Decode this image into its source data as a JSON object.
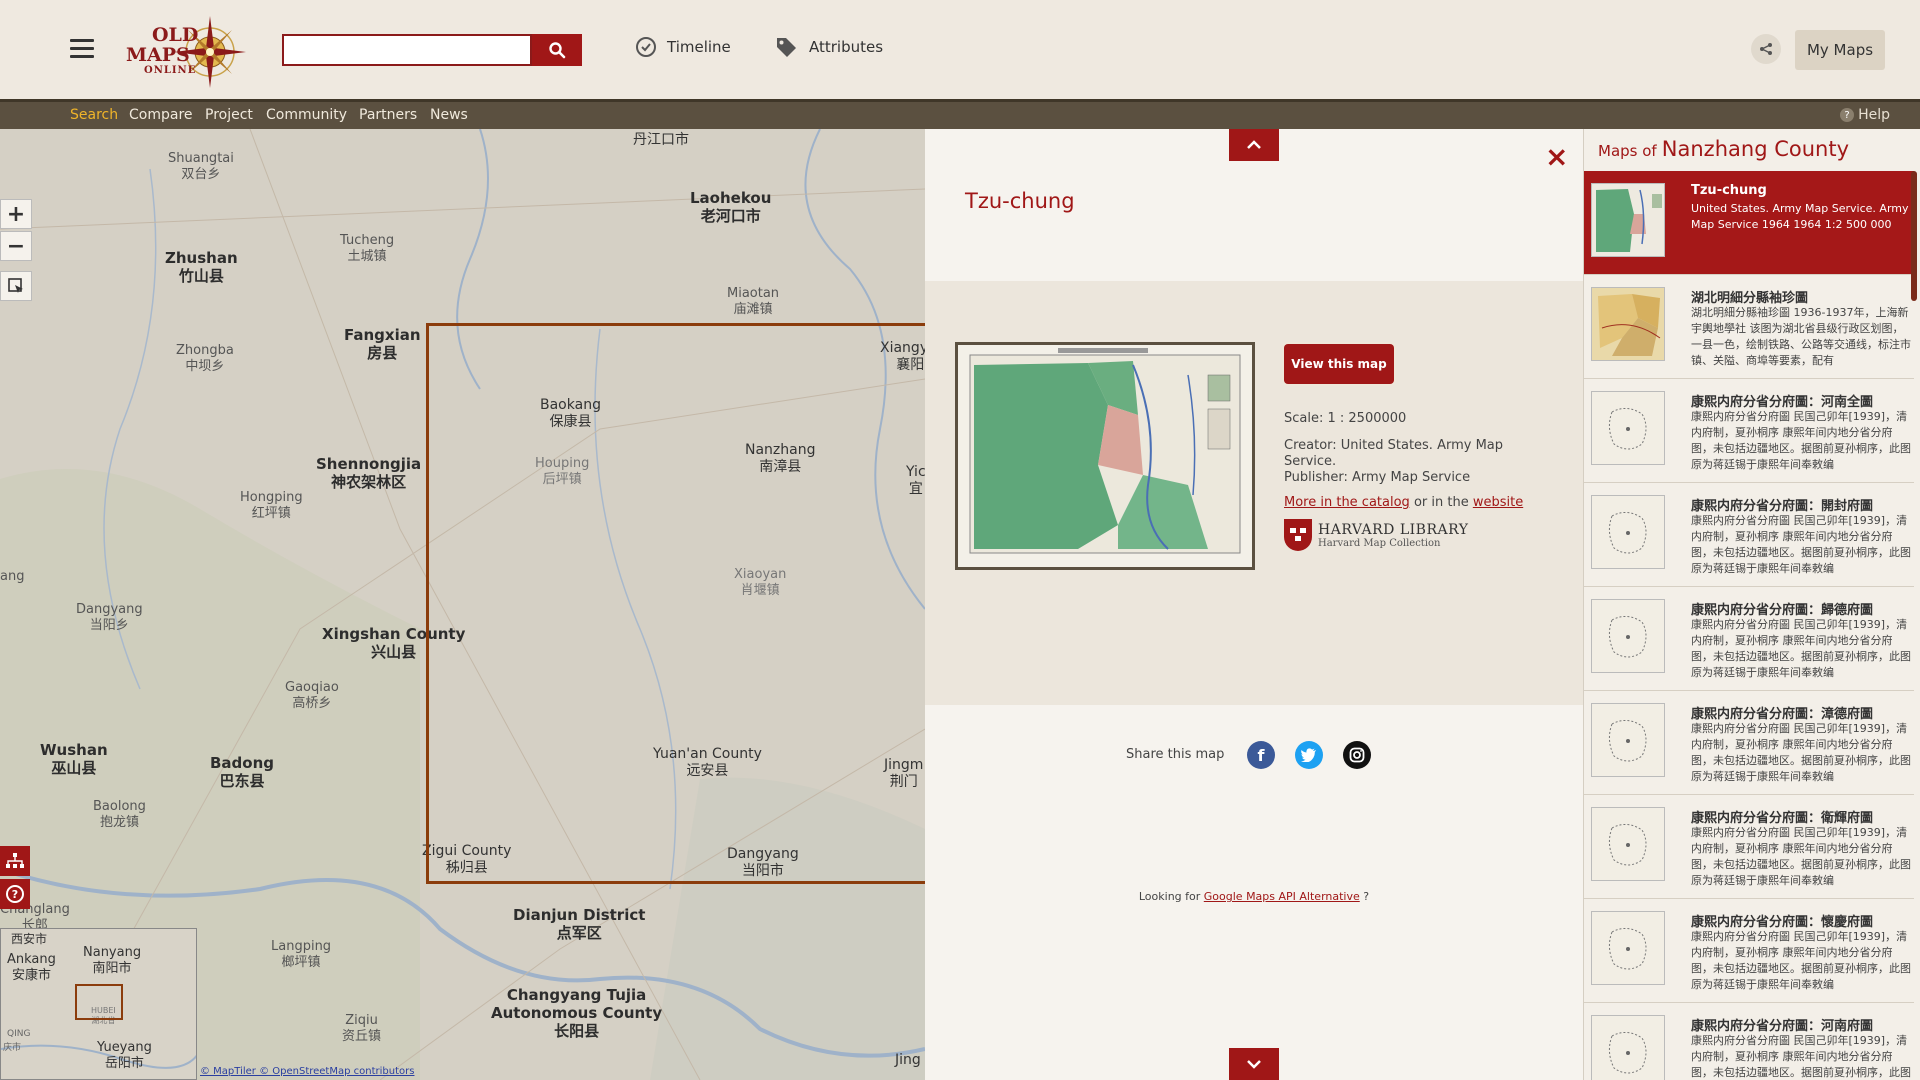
{
  "header": {
    "logo_line1": "OLD",
    "logo_line2": "MAPS",
    "logo_line3": "ONLINE",
    "search_value": "",
    "timeline_label": "Timeline",
    "attributes_label": "Attributes",
    "mymaps_label": "My Maps"
  },
  "subnav": {
    "items": [
      "Search",
      "Compare",
      "Project",
      "Community",
      "Partners",
      "News"
    ],
    "help_label": "Help"
  },
  "map": {
    "places": [
      {
        "name": "丹江口市"
      },
      {
        "name": "Shuangtai",
        "name2": "双台乡"
      },
      {
        "name": "Laohekou",
        "name2": "老河口市"
      },
      {
        "name": "Zhushan",
        "name2": "竹山县"
      },
      {
        "name": "Tucheng",
        "name2": "土城镇"
      },
      {
        "name": "Miaotan",
        "name2": "庙滩镇"
      },
      {
        "name": "Zhongba",
        "name2": "中坝乡"
      },
      {
        "name": "Fangxian",
        "name2": "房县"
      },
      {
        "name": "Xiangyang",
        "name2": "襄阳市"
      },
      {
        "name": "Baokang",
        "name2": "保康县"
      },
      {
        "name": "Houping",
        "name2": "后坪镇"
      },
      {
        "name": "Nanzhang",
        "name2": "南漳县"
      },
      {
        "name": "Shennongjia",
        "name2": "神农架林区"
      },
      {
        "name": "Hongping",
        "name2": "红坪镇"
      },
      {
        "name": "Xiaoyan",
        "name2": "肖堰镇"
      },
      {
        "name": "Dangyang",
        "name2": "当阳乡"
      },
      {
        "name": "Xingshan County",
        "name2": "兴山县"
      },
      {
        "name": "Gaoqiao",
        "name2": "高桥乡"
      },
      {
        "name": "Wushan",
        "name2": "巫山县"
      },
      {
        "name": "Badong",
        "name2": "巴东县"
      },
      {
        "name": "Yuan'an County",
        "name2": "远安县"
      },
      {
        "name": "Baolong",
        "name2": "抱龙镇"
      },
      {
        "name": "Zigui County",
        "name2": "秭归县"
      },
      {
        "name": "Dangyang",
        "name2": "当阳市"
      },
      {
        "name": "Dianjun District",
        "name2": "点军区"
      },
      {
        "name": "Changlang",
        "name2": "长郎"
      },
      {
        "name": "Langping",
        "name2": "榔坪镇"
      },
      {
        "name": "Changyang Tujia",
        "name2": "Autonomous County"
      },
      {
        "name": "长阳县"
      },
      {
        "name": "Ziqiu",
        "name2": "资丘镇"
      },
      {
        "name": "Jingm",
        "name2": "荆门"
      },
      {
        "name": "Yic",
        "name2": "宜"
      },
      {
        "name": "Jing"
      },
      {
        "name": "ang"
      }
    ],
    "overview_places": [
      {
        "name": "西安市"
      },
      {
        "name": "Ankang",
        "name2": "安康市"
      },
      {
        "name": "Nanyang",
        "name2": "南阳市"
      },
      {
        "name": "HUBEI",
        "name2": "湖北省"
      },
      {
        "name": "QING"
      },
      {
        "name": "庆市"
      },
      {
        "name": "Yueyang",
        "name2": "岳阳市"
      }
    ],
    "attribution": "© MapTiler © OpenStreetMap contributors"
  },
  "detail": {
    "title": "Tzu-chung",
    "view_button": "View this map",
    "scale": "Scale: 1 : 2500000",
    "creator": "Creator: United States. Army Map Service.",
    "publisher": "Publisher: Army Map Service",
    "catalog_link": "More in the catalog",
    "or_text": " or in the ",
    "website_link": "website",
    "library_name": "HARVARD LIBRARY",
    "library_sub": "Harvard Map Collection",
    "share_label": "Share this map",
    "looking_prefix": "Looking for ",
    "looking_link": "Google Maps API Alternative",
    "looking_suffix": " ?"
  },
  "list": {
    "header_prefix": "Maps of",
    "header_name": "Nanzhang County",
    "items": [
      {
        "title": "Tzu-chung",
        "desc": "United States. Army Map Service. Army Map Service 1964 1964 1:2 500 000",
        "active": true
      },
      {
        "title": "湖北明細分縣袖珍圖",
        "desc": "湖北明細分縣袖珍圖 1936-1937年，上海新宇輿地學社 该图为湖北省县级行政区划图，一县一色，绘制铁路、公路等交通线，标注市镇、关隘、商埠等要素，配有",
        "active": false
      },
      {
        "title": "康熙内府分省分府圖：河南全圖",
        "desc": "康熙内府分省分府圖 民国己卯年[1939]，清内府制，夏孙桐序 康熙年间内地分省分府图，未包括边疆地区。据图前夏孙桐序，此图原为蒋廷锡于康熙年间奉敕编",
        "active": false
      },
      {
        "title": "康熙内府分省分府圖：開封府圖",
        "desc": "康熙内府分省分府圖 民国己卯年[1939]，清内府制，夏孙桐序 康熙年间内地分省分府图，未包括边疆地区。据图前夏孙桐序，此图原为蒋廷锡于康熙年间奉敕编",
        "active": false
      },
      {
        "title": "康熙内府分省分府圖：歸德府圖",
        "desc": "康熙内府分省分府圖 民国己卯年[1939]，清内府制，夏孙桐序 康熙年间内地分省分府图，未包括边疆地区。据图前夏孙桐序，此图原为蒋廷锡于康熙年间奉敕编",
        "active": false
      },
      {
        "title": "康熙内府分省分府圖：漳德府圖",
        "desc": "康熙内府分省分府圖 民国己卯年[1939]，清内府制，夏孙桐序 康熙年间内地分省分府图，未包括边疆地区。据图前夏孙桐序，此图原为蒋廷锡于康熙年间奉敕编",
        "active": false
      },
      {
        "title": "康熙内府分省分府圖：衛輝府圖",
        "desc": "康熙内府分省分府圖 民国己卯年[1939]，清内府制，夏孙桐序 康熙年间内地分省分府图，未包括边疆地区。据图前夏孙桐序，此图原为蒋廷锡于康熙年间奉敕编",
        "active": false
      },
      {
        "title": "康熙内府分省分府圖：懷慶府圖",
        "desc": "康熙内府分省分府圖 民国己卯年[1939]，清内府制，夏孙桐序 康熙年间内地分省分府图，未包括边疆地区。据图前夏孙桐序，此图原为蒋廷锡于康熙年间奉敕编",
        "active": false
      },
      {
        "title": "康熙内府分省分府圖：河南府圖",
        "desc": "康熙内府分省分府圖 民国己卯年[1939]，清内府制，夏孙桐序 康熙年间内地分省分府图，未包括边疆地区。据图前夏孙桐序，此图原为蒋廷锡于康熙年间奉敕编",
        "active": false
      }
    ]
  },
  "colors": {
    "accent": "#a01717",
    "subnav_bg": "#5b5040",
    "active_nav": "#f0b429"
  }
}
